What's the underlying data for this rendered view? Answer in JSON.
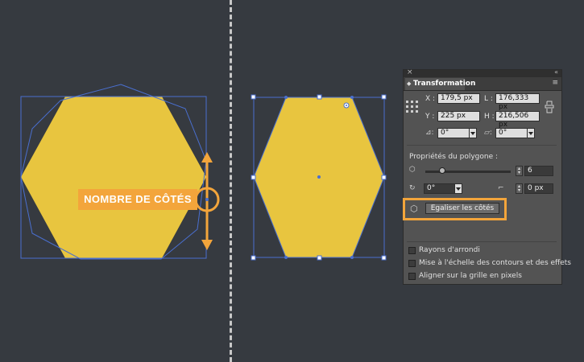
{
  "callout": {
    "label": "NOMBRE DE CÔTÉS"
  },
  "panel": {
    "close_glyph": "×",
    "collapse_glyph": "«",
    "tab_label": "Transformation",
    "menu_glyph": "≡",
    "x_label": "X :",
    "x_value": "179,5 px",
    "y_label": "Y :",
    "y_value": "225 px",
    "w_label": "L :",
    "w_value": "176,333 px",
    "h_label": "H :",
    "h_value": "216,506 px",
    "rotate_value": "0°",
    "shear_value": "0°",
    "polygon_title": "Propriétés du polygone :",
    "sides_value": "6",
    "corner_angle_value": "0°",
    "corner_radius_value": "0 px",
    "equalize_button": "Egaliser les côtés",
    "checkboxes": [
      {
        "label": "Rayons d'arrondi",
        "checked": false
      },
      {
        "label": "Mise à l'échelle des contours et des effets",
        "checked": false
      },
      {
        "label": "Aligner sur la grille en pixels",
        "checked": false
      }
    ]
  },
  "colors": {
    "hexagon_fill": "#e8c53f",
    "selection": "#4a6fcf",
    "accent": "#f3a53b",
    "background": "#363a40"
  }
}
